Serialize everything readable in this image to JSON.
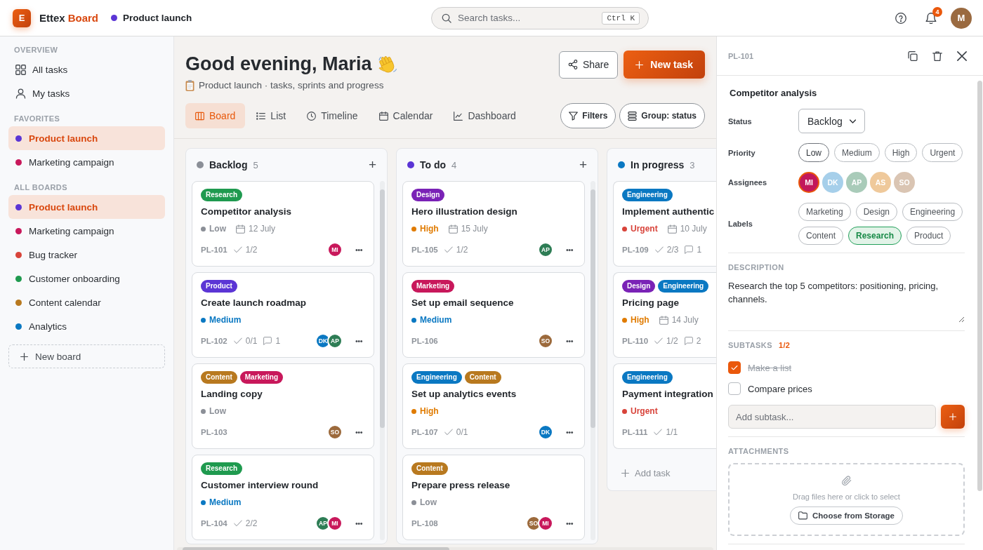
{
  "topbar": {
    "logo": "E",
    "app_name": "Ettex",
    "app_name_accent": "Board",
    "board": {
      "name": "Product launch",
      "color": "#5b35d5"
    },
    "search": {
      "placeholder": "Search tasks...",
      "shortcut": "Ctrl K"
    },
    "notifications": "4",
    "avatar": "M"
  },
  "sidebar": {
    "sections": [
      {
        "title": "OVERVIEW",
        "items": [
          {
            "label": "All tasks",
            "kind": "grid",
            "selected": false
          },
          {
            "label": "My tasks",
            "kind": "person",
            "selected": false
          }
        ]
      },
      {
        "title": "FAVORITES",
        "items": [
          {
            "label": "Product launch",
            "kind": "board",
            "color": "#5b35d5",
            "selected": true
          },
          {
            "label": "Marketing campaign",
            "kind": "board",
            "color": "#c8185b",
            "selected": false
          }
        ]
      },
      {
        "title": "ALL BOARDS",
        "items": [
          {
            "label": "Product launch",
            "kind": "board",
            "color": "#5b35d5",
            "selected": true
          },
          {
            "label": "Marketing campaign",
            "kind": "board",
            "color": "#c8185b",
            "selected": false
          },
          {
            "label": "Bug tracker",
            "kind": "board",
            "color": "#d8443a",
            "selected": false
          },
          {
            "label": "Customer onboarding",
            "kind": "board",
            "color": "#1f9a4f",
            "selected": false
          },
          {
            "label": "Content calendar",
            "kind": "board",
            "color": "#b8791f",
            "selected": false
          },
          {
            "label": "Analytics",
            "kind": "board",
            "color": "#0a78c2",
            "selected": false
          }
        ]
      }
    ],
    "new_board": "New board"
  },
  "main": {
    "title": "Good evening, Maria",
    "subtitle": "Product launch · tasks, sprints and progress",
    "share": "Share",
    "new_task": "New task",
    "views": [
      {
        "label": "Board",
        "kind": "columns",
        "selected": true
      },
      {
        "label": "List",
        "kind": "list",
        "selected": false
      },
      {
        "label": "Timeline",
        "kind": "clock",
        "selected": false
      },
      {
        "label": "Calendar",
        "kind": "calendar",
        "selected": false
      },
      {
        "label": "Dashboard",
        "kind": "chart",
        "selected": false
      }
    ],
    "filters": "Filters",
    "group": "Group: status"
  },
  "board": {
    "columns": [
      {
        "name": "Backlog",
        "count": "5",
        "color": "#8b8f97",
        "add": "+",
        "scrollbar": true,
        "cards": [
          {
            "tags": [
              {
                "label": "Research",
                "color": "#1f9a4f"
              }
            ],
            "title": "Competitor analysis",
            "priority": {
              "label": "Low",
              "color": "#8b8f97"
            },
            "due": "12 July",
            "id": "PL-101",
            "subtasks": "1/2",
            "assignees": [
              {
                "initials": "MI",
                "color": "#c8185b"
              }
            ],
            "menu": "•••"
          },
          {
            "tags": [
              {
                "label": "Product",
                "color": "#5b35d5"
              }
            ],
            "title": "Create launch roadmap",
            "priority": {
              "label": "Medium",
              "color": "#0a78c2"
            },
            "id": "PL-102",
            "subtasks": "0/1",
            "comments": "1",
            "assignees": [
              {
                "initials": "DK",
                "color": "#0a78c2"
              },
              {
                "initials": "AP",
                "color": "#2e7d55"
              }
            ],
            "menu": "•••"
          },
          {
            "tags": [
              {
                "label": "Content",
                "color": "#b8791f"
              },
              {
                "label": "Marketing",
                "color": "#c8185b"
              }
            ],
            "title": "Landing copy",
            "priority": {
              "label": "Low",
              "color": "#8b8f97"
            },
            "id": "PL-103",
            "assignees": [
              {
                "initials": "SO",
                "color": "#9c6a3c"
              }
            ],
            "menu": "•••"
          },
          {
            "tags": [
              {
                "label": "Research",
                "color": "#1f9a4f"
              }
            ],
            "title": "Customer interview round",
            "priority": {
              "label": "Medium",
              "color": "#0a78c2"
            },
            "id": "PL-104",
            "subtasks": "2/2",
            "assignees": [
              {
                "initials": "AP",
                "color": "#2e7d55"
              },
              {
                "initials": "MI",
                "color": "#c8185b"
              }
            ],
            "menu": "•••"
          }
        ]
      },
      {
        "name": "To do",
        "count": "4",
        "color": "#5b35d5",
        "add": "+",
        "scrollbar": true,
        "cards": [
          {
            "tags": [
              {
                "label": "Design",
                "color": "#7a22b6"
              }
            ],
            "title": "Hero illustration design",
            "priority": {
              "label": "High",
              "color": "#e07b00"
            },
            "due": "15 July",
            "id": "PL-105",
            "subtasks": "1/2",
            "assignees": [
              {
                "initials": "AP",
                "color": "#2e7d55"
              }
            ],
            "menu": "•••"
          },
          {
            "tags": [
              {
                "label": "Marketing",
                "color": "#c8185b"
              }
            ],
            "title": "Set up email sequence",
            "priority": {
              "label": "Medium",
              "color": "#0a78c2"
            },
            "id": "PL-106",
            "assignees": [
              {
                "initials": "SO",
                "color": "#9c6a3c"
              }
            ],
            "menu": "•••"
          },
          {
            "tags": [
              {
                "label": "Engineering",
                "color": "#0a78c2"
              },
              {
                "label": "Content",
                "color": "#b8791f"
              }
            ],
            "title": "Set up analytics events",
            "priority": {
              "label": "High",
              "color": "#e07b00"
            },
            "id": "PL-107",
            "subtasks": "0/1",
            "assignees": [
              {
                "initials": "DK",
                "color": "#0a78c2"
              }
            ],
            "menu": "•••"
          },
          {
            "tags": [
              {
                "label": "Content",
                "color": "#b8791f"
              }
            ],
            "title": "Prepare press release",
            "priority": {
              "label": "Low",
              "color": "#8b8f97"
            },
            "id": "PL-108",
            "assignees": [
              {
                "initials": "SO",
                "color": "#9c6a3c"
              },
              {
                "initials": "MI",
                "color": "#c8185b"
              }
            ],
            "menu": "•••"
          }
        ]
      },
      {
        "name": "In progress",
        "count": "3",
        "color": "#0a78c2",
        "scrollbar": false,
        "cards": [
          {
            "tags": [
              {
                "label": "Engineering",
                "color": "#0a78c2"
              }
            ],
            "title": "Implement authentic",
            "priority": {
              "label": "Urgent",
              "color": "#d8433a"
            },
            "due": "10 July",
            "id": "PL-109",
            "subtasks": "2/3",
            "comments": "1"
          },
          {
            "tags": [
              {
                "label": "Design",
                "color": "#7a22b6"
              },
              {
                "label": "Engineering",
                "color": "#0a78c2"
              }
            ],
            "title": "Pricing page",
            "priority": {
              "label": "High",
              "color": "#e07b00"
            },
            "due": "14 July",
            "id": "PL-110",
            "subtasks": "1/2",
            "comments": "2"
          },
          {
            "tags": [
              {
                "label": "Engineering",
                "color": "#0a78c2"
              }
            ],
            "title": "Payment integration",
            "priority": {
              "label": "Urgent",
              "color": "#d8433a"
            },
            "id": "PL-111",
            "subtasks": "1/1"
          }
        ],
        "add_task": "Add task"
      }
    ]
  },
  "detail": {
    "id": "PL-101",
    "title": "Competitor analysis",
    "status": {
      "label": "Status",
      "value": "Backlog"
    },
    "priority": {
      "label": "Priority",
      "options": [
        {
          "label": "Low",
          "selected": true
        },
        {
          "label": "Medium",
          "selected": false
        },
        {
          "label": "High",
          "selected": false
        },
        {
          "label": "Urgent",
          "selected": false
        }
      ]
    },
    "assignees": {
      "label": "Assignees",
      "people": [
        {
          "initials": "MI",
          "color": "#c2185b",
          "selected": true
        },
        {
          "initials": "DK",
          "color": "#a6cfea",
          "selected": false
        },
        {
          "initials": "AP",
          "color": "#a9cbb9",
          "selected": false
        },
        {
          "initials": "AS",
          "color": "#efc99b",
          "selected": false
        },
        {
          "initials": "SO",
          "color": "#dac5b3",
          "selected": false
        }
      ]
    },
    "labels": {
      "label": "Labels",
      "options": [
        {
          "label": "Marketing",
          "selected": false
        },
        {
          "label": "Design",
          "selected": false
        },
        {
          "label": "Engineering",
          "selected": false
        },
        {
          "label": "Content",
          "selected": false
        },
        {
          "label": "Research",
          "selected": true
        },
        {
          "label": "Product",
          "selected": false
        }
      ]
    },
    "description": {
      "heading": "DESCRIPTION",
      "text": "Research the top 5 competitors: positioning, pricing, channels."
    },
    "subtasks": {
      "heading": "SUBTASKS",
      "done_count": "1/2",
      "items": [
        {
          "label": "Make a list",
          "checked": true
        },
        {
          "label": "Compare prices",
          "checked": false
        }
      ],
      "placeholder": "Add subtask..."
    },
    "attachments": {
      "heading": "ATTACHMENTS",
      "hint": "Drag files here or click to select",
      "button": "Choose from Storage"
    }
  }
}
